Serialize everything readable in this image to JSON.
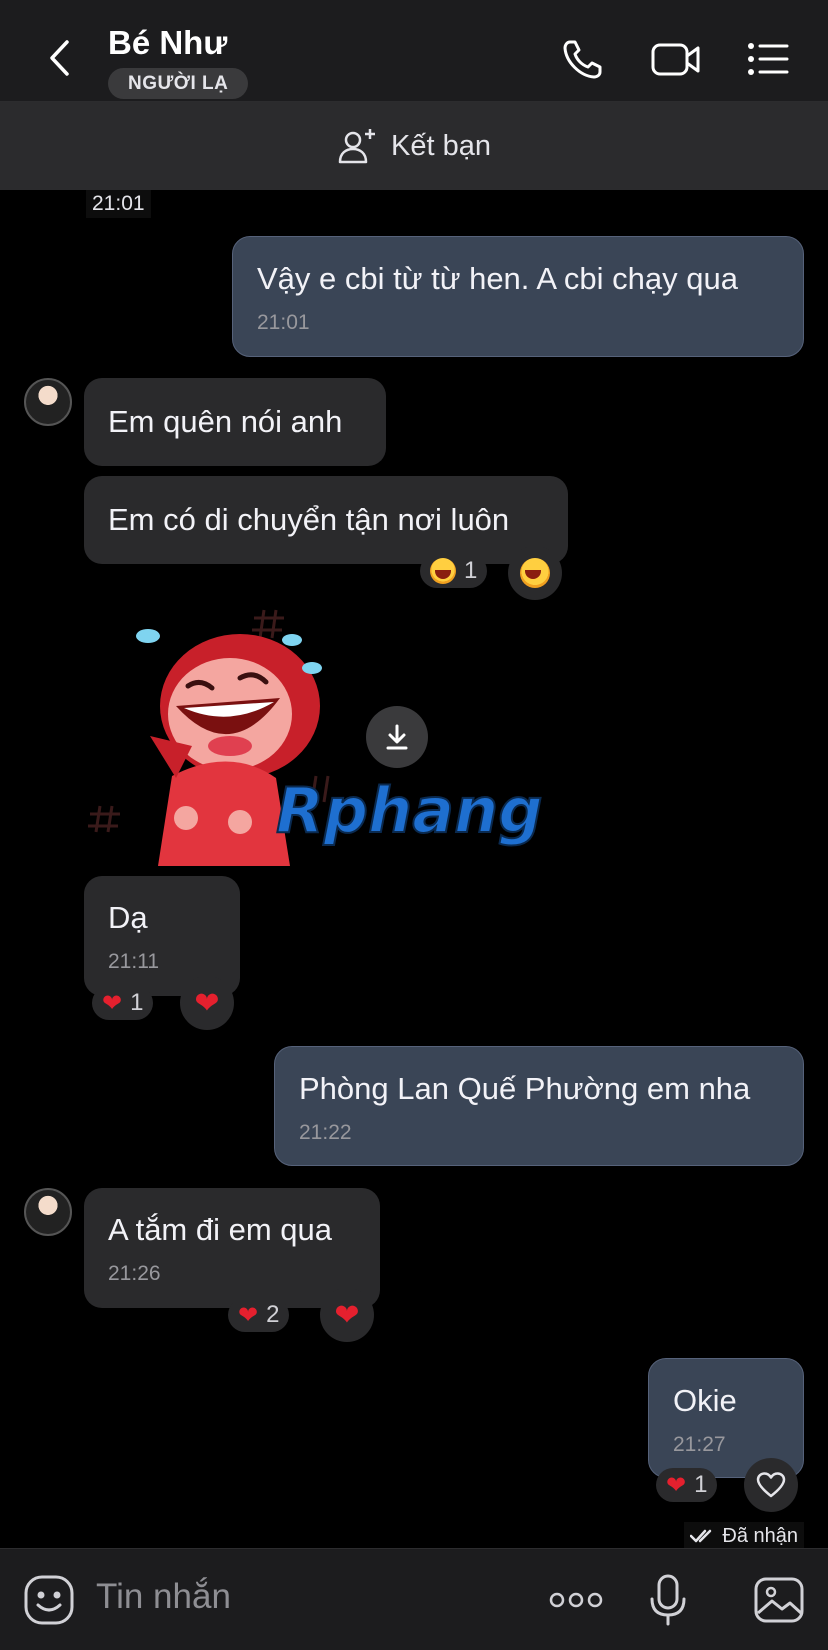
{
  "header": {
    "title": "Bé Như",
    "badge": "NGƯỜI LẠ"
  },
  "friend_bar": {
    "label": "Kết bạn"
  },
  "top_time": "21:01",
  "messages": [
    {
      "side": "mine",
      "text": "Vậy e cbi từ từ hen. A cbi chạy qua",
      "time": "21:01"
    },
    {
      "side": "theirs",
      "text": "Em quên nói anh"
    },
    {
      "side": "theirs",
      "text": "Em có di chuyển tận nơi luôn",
      "reaction": {
        "emoji": "laugh",
        "count": "1"
      }
    },
    {
      "side": "theirs",
      "type": "sticker",
      "sticker_text": "Rphang"
    },
    {
      "side": "theirs",
      "text": "Dạ",
      "time": "21:11",
      "reaction": {
        "emoji": "heart",
        "count": "1"
      }
    },
    {
      "side": "mine",
      "text": "Phòng Lan Quế Phường em nha",
      "time": "21:22"
    },
    {
      "side": "theirs",
      "text": "A tắm đi em qua",
      "time": "21:26",
      "reaction": {
        "emoji": "heart",
        "count": "2"
      }
    },
    {
      "side": "mine",
      "text": "Okie",
      "time": "21:27",
      "reaction": {
        "emoji": "heart",
        "count": "1"
      }
    }
  ],
  "status": {
    "received": "Đã nhận"
  },
  "input": {
    "placeholder": "Tin nhắn"
  },
  "colors": {
    "mine_bubble": "#3a4556",
    "theirs_bubble": "#2a2a2c",
    "heart": "#e5202e"
  },
  "icons": [
    "back-icon",
    "phone-icon",
    "video-icon",
    "list-icon",
    "add-friend-icon",
    "download-icon",
    "sticker-icon",
    "more-icon",
    "mic-icon",
    "image-icon"
  ]
}
